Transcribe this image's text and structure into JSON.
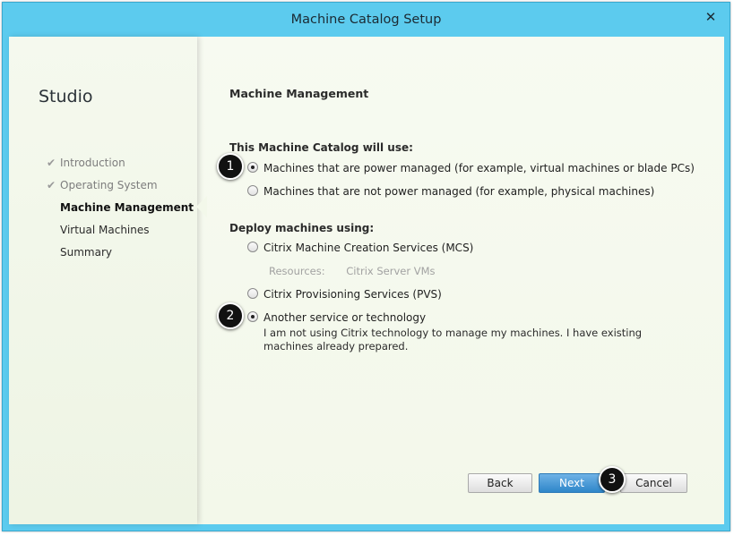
{
  "window": {
    "title": "Machine Catalog Setup",
    "close_icon": "close-icon"
  },
  "nav": {
    "studio_title": "Studio",
    "items": [
      {
        "label": "Introduction",
        "state": "done"
      },
      {
        "label": "Operating System",
        "state": "done"
      },
      {
        "label": "Machine Management",
        "state": "active"
      },
      {
        "label": "Virtual Machines",
        "state": "pending"
      },
      {
        "label": "Summary",
        "state": "pending"
      }
    ]
  },
  "content": {
    "section_title": "Machine Management",
    "catalog_use": {
      "label": "This Machine Catalog will use:",
      "options": [
        {
          "label": "Machines that are power managed (for example, virtual machines or blade PCs)",
          "checked": true
        },
        {
          "label": "Machines that are not power managed (for example, physical machines)",
          "checked": false
        }
      ]
    },
    "deploy": {
      "label": "Deploy machines using:",
      "options": [
        {
          "label": "Citrix Machine Creation Services (MCS)",
          "checked": false
        },
        {
          "label": "Citrix Provisioning Services (PVS)",
          "checked": false
        },
        {
          "label": "Another service or technology",
          "checked": true
        }
      ],
      "resources_label": "Resources:",
      "resources_value": "Citrix Server VMs",
      "another_description": "I am not using Citrix technology to manage my machines. I have existing machines already prepared."
    }
  },
  "buttons": {
    "back": "Back",
    "next": "Next",
    "cancel": "Cancel"
  },
  "badges": {
    "one": "1",
    "two": "2",
    "three": "3"
  },
  "colors": {
    "title_bar": "#5ccbee",
    "next_button": "#2e86c9",
    "badge": "#111111"
  }
}
